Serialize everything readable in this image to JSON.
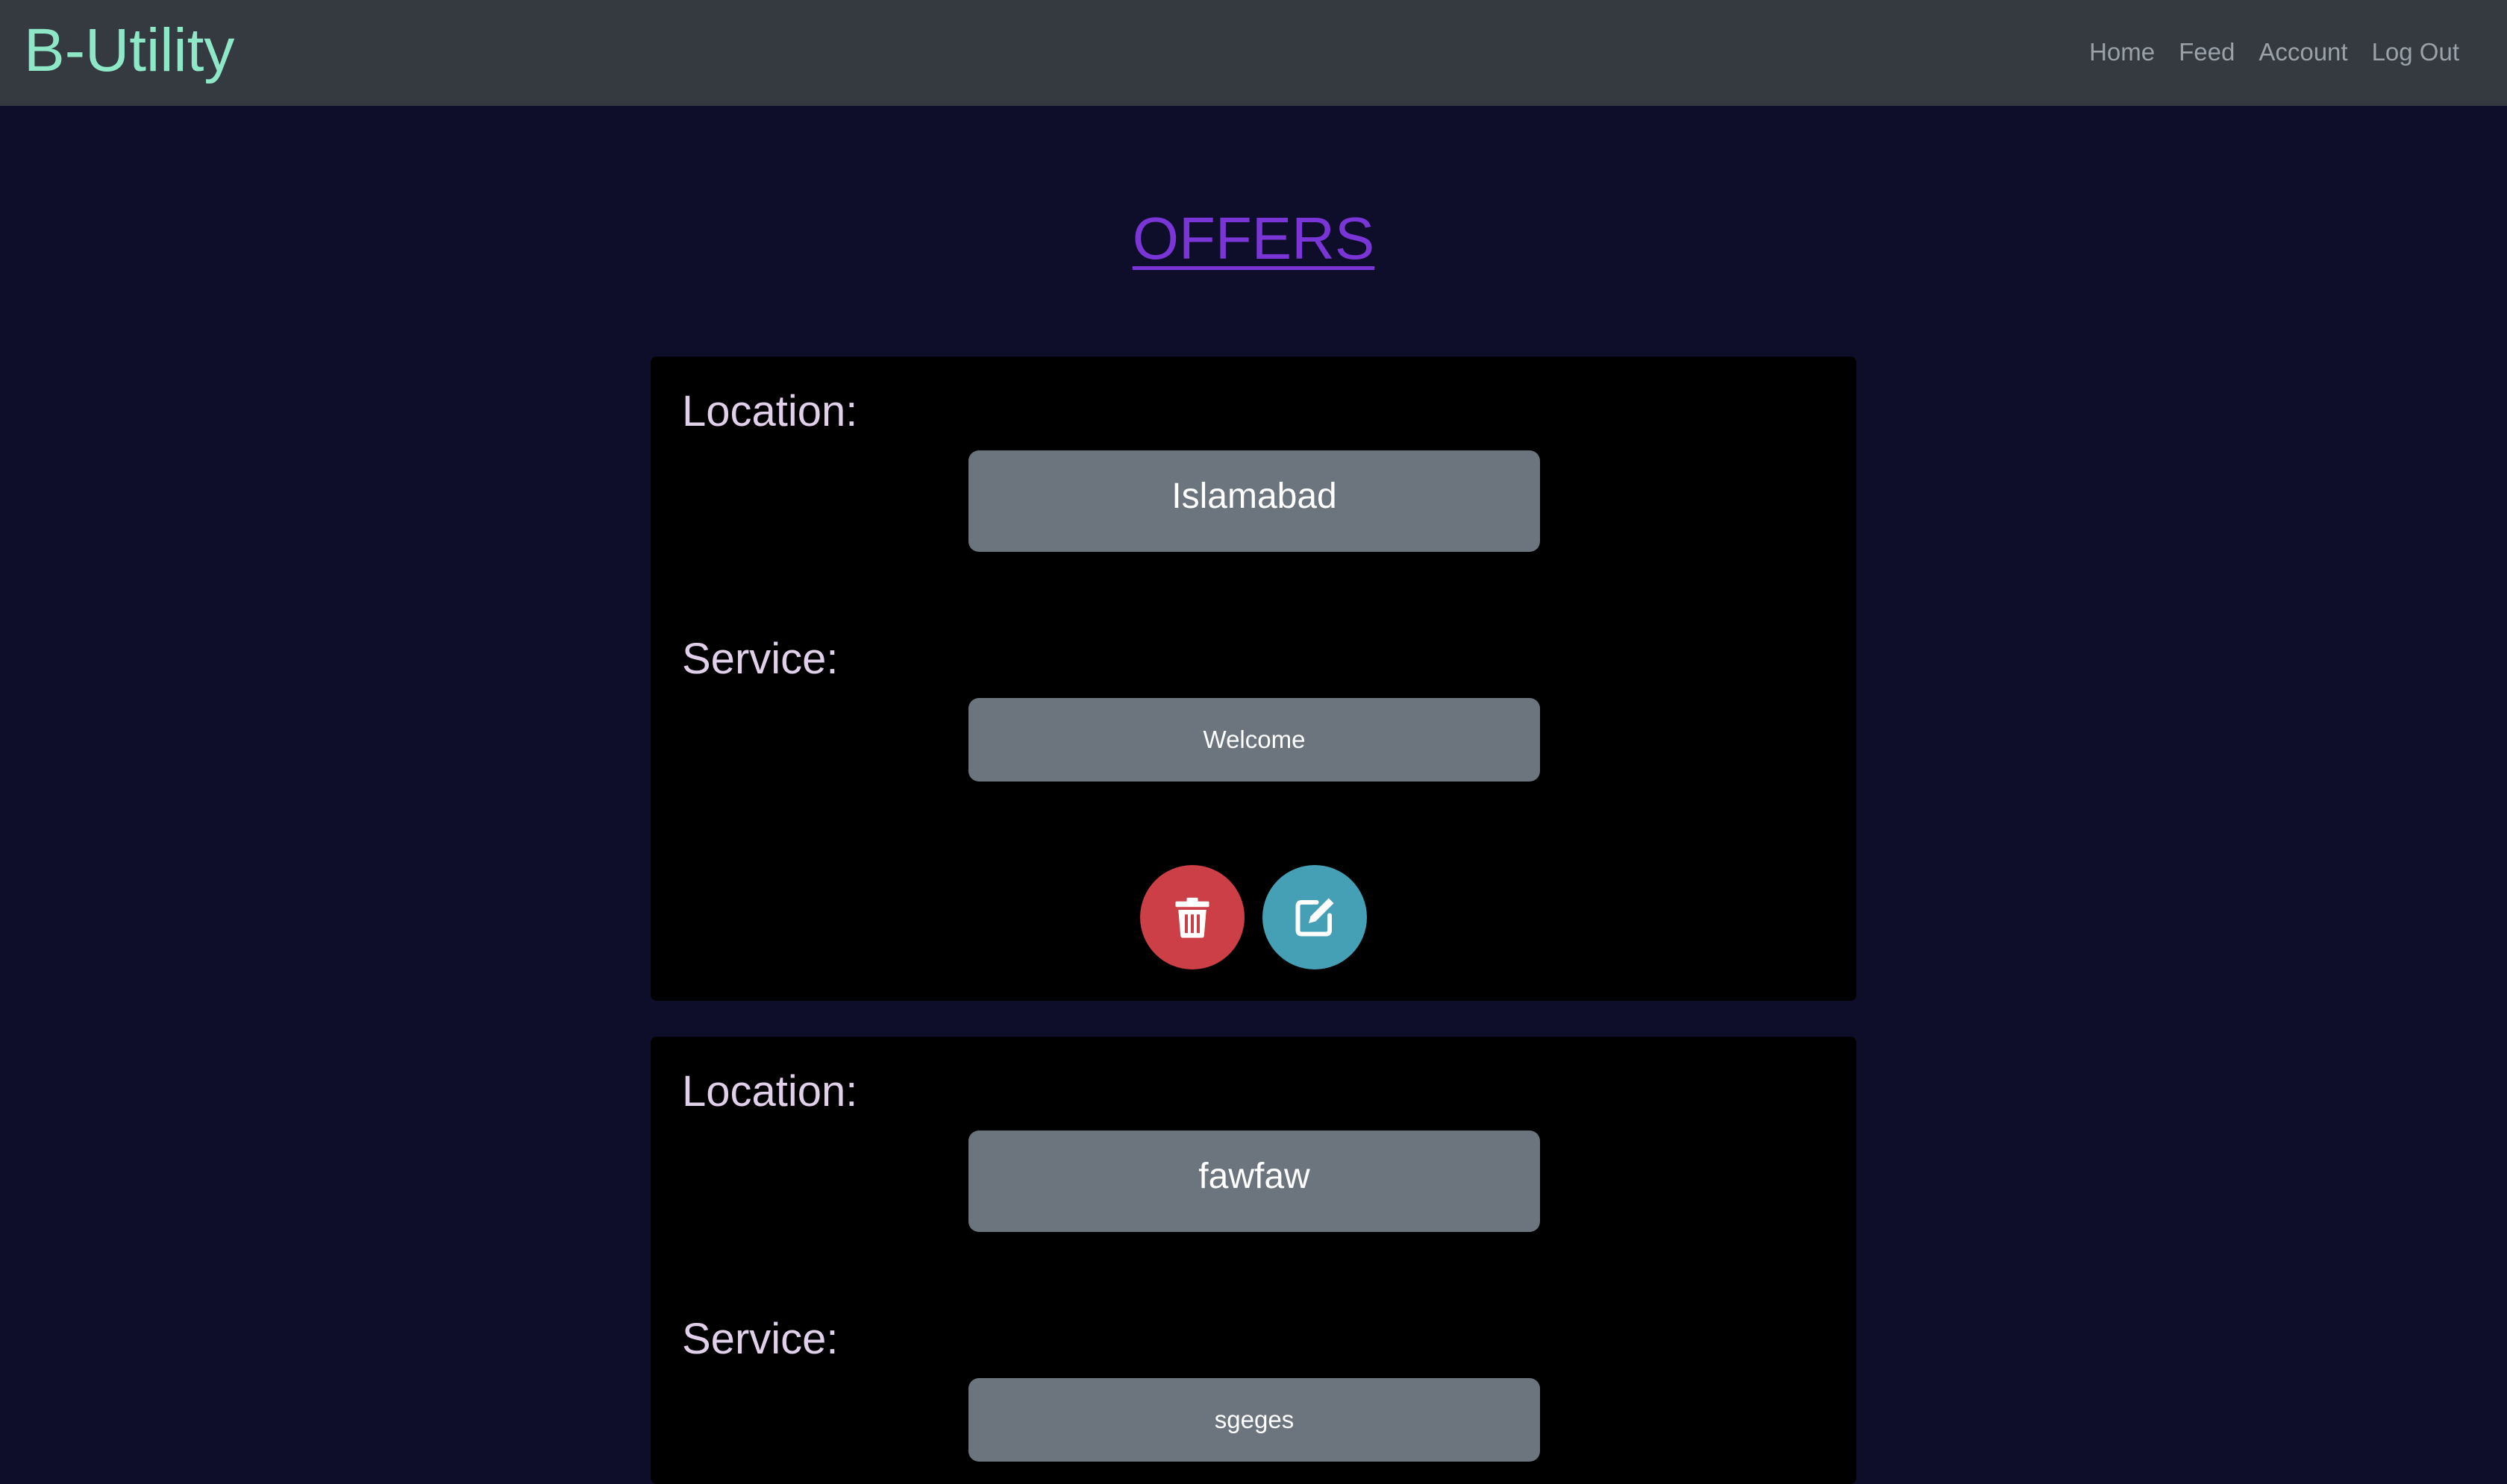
{
  "navbar": {
    "brand": "B-Utility",
    "links": [
      "Home",
      "Feed",
      "Account",
      "Log Out"
    ]
  },
  "page": {
    "title": "OFFERS"
  },
  "offers": [
    {
      "location_label": "Location:",
      "location": "Islamabad",
      "service_label": "Service:",
      "service": "Welcome",
      "actions": [
        "trash-icon",
        "edit-icon"
      ]
    },
    {
      "location_label": "Location:",
      "location": "fawfaw",
      "service_label": "Service:",
      "service": "sgeges"
    }
  ],
  "colors": {
    "background": "#0e0e2b",
    "navbar": "#343a40",
    "brand": "#8ee8c8",
    "title": "#7a35d6",
    "card": "#000000",
    "value_box": "#6c757d",
    "delete": "#cc3f46",
    "edit": "#45a0b5"
  }
}
